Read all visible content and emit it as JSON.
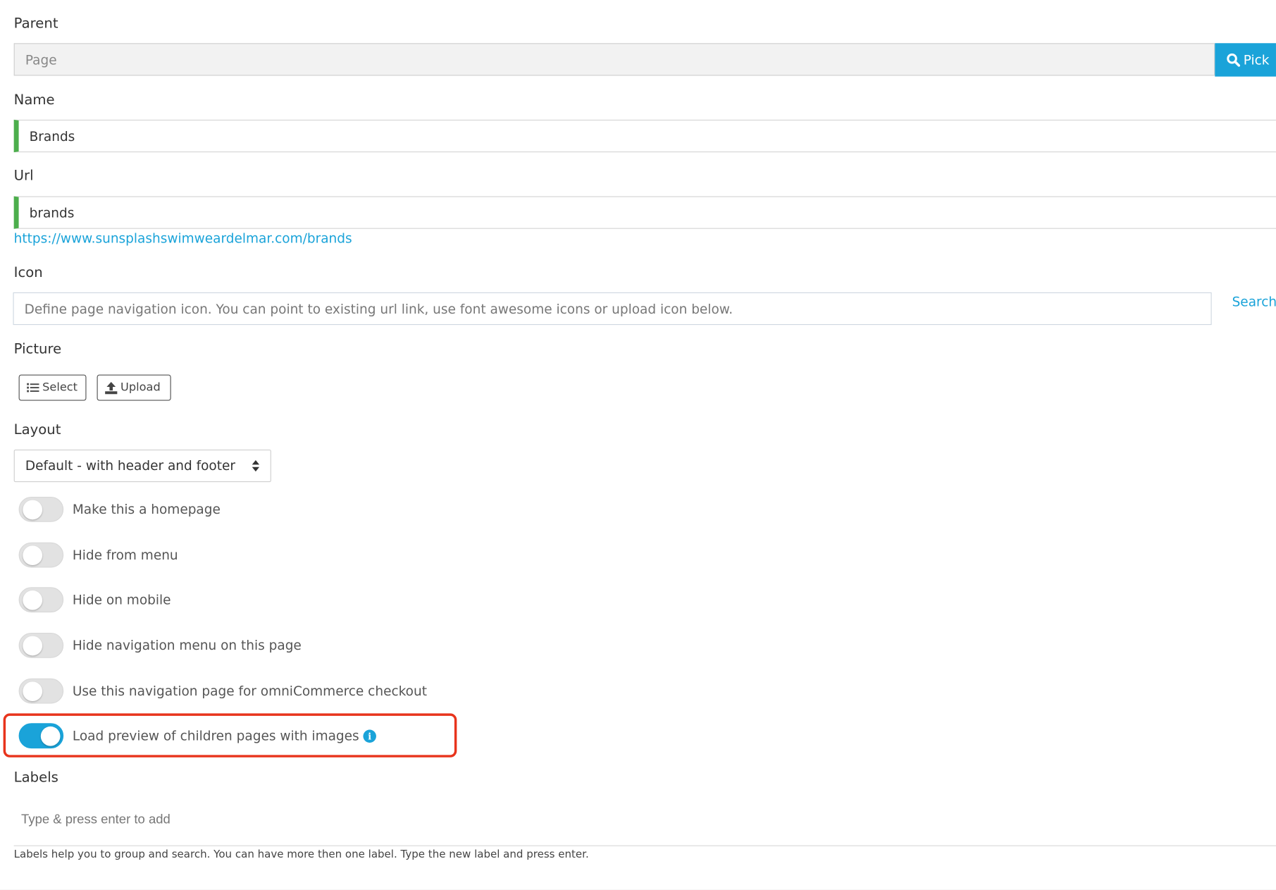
{
  "parent": {
    "label": "Parent",
    "placeholder": "Page",
    "pick_label": "Pick"
  },
  "name": {
    "label": "Name",
    "value": "Brands"
  },
  "url": {
    "label": "Url",
    "value": "brands",
    "link": "https://www.sunsplashswimweardelmar.com/brands"
  },
  "icon": {
    "label": "Icon",
    "placeholder": "Define page navigation icon. You can point to existing url link, use font awesome icons or upload icon below.",
    "search_label": "Search"
  },
  "picture": {
    "label": "Picture",
    "select_label": "Select",
    "upload_label": "Upload"
  },
  "layout": {
    "label": "Layout",
    "selected": "Default - with header and footer"
  },
  "toggles": [
    {
      "label": "Make this a homepage",
      "on": false
    },
    {
      "label": "Hide from menu",
      "on": false
    },
    {
      "label": "Hide on mobile",
      "on": false
    },
    {
      "label": "Hide navigation menu on this page",
      "on": false
    },
    {
      "label": "Use this navigation page for omniCommerce checkout",
      "on": false
    },
    {
      "label": "Load preview of children pages with images",
      "on": true,
      "info_icon": "i"
    }
  ],
  "labels": {
    "label": "Labels",
    "placeholder": "Type & press enter to add",
    "help": "Labels help you to group and search. You can have more then one label. Type the new label and press enter."
  },
  "colors": {
    "accent": "#1aa3d9",
    "valid": "#4cae4c",
    "highlight": "#e8341c"
  }
}
